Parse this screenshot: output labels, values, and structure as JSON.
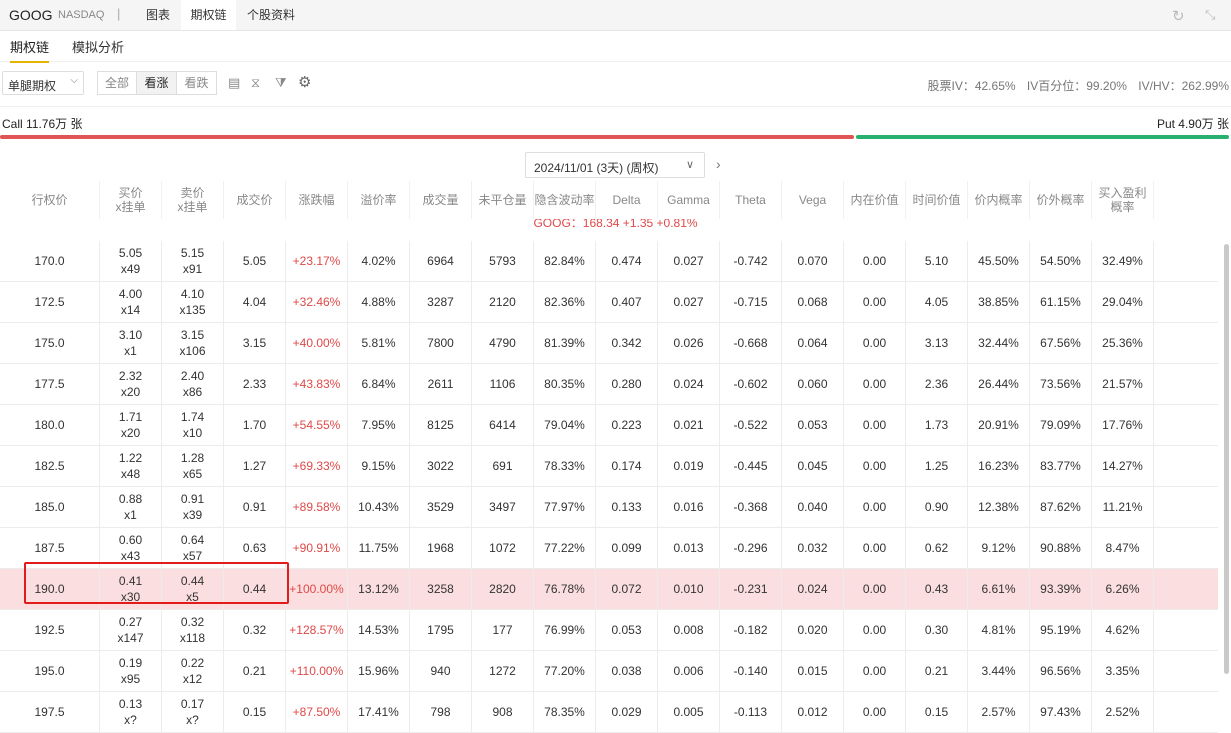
{
  "header": {
    "ticker": "GOOG",
    "exchange": "NASDAQ",
    "separator": "|",
    "tabs": [
      "图表",
      "期权链",
      "个股资料"
    ],
    "active_tab": "期权链",
    "refresh_icon": "refresh-icon",
    "compress_icon": "compress-icon"
  },
  "subtabs": [
    "期权链",
    "模拟分析"
  ],
  "toolbar": {
    "leg_select": "单腿期权",
    "filter_segments": [
      "全部",
      "看涨",
      "看跌"
    ],
    "active_filter": "看涨",
    "icons": [
      "layout-icon",
      "split-icon",
      "filter-icon",
      "settings-icon"
    ],
    "stock_iv": "股票IV：42.65%",
    "iv_percentile": "IV百分位：99.20%",
    "iv_hv": "IV/HV：262.99%"
  },
  "volume_bar": {
    "call_label": "Call 11.76万 张",
    "put_label": "Put 4.90万 张",
    "call_fraction": 0.706,
    "put_fraction": 0.294,
    "call_color": "#e05454",
    "put_color": "#27b06e"
  },
  "expiry": {
    "selected": "2024/11/01 (3天) (周权)"
  },
  "table": {
    "headers": [
      "行权价",
      "买价\nx挂单",
      "卖价\nx挂单",
      "成交价",
      "涨跌幅",
      "溢价率",
      "成交量",
      "未平仓量",
      "隐含波动率",
      "Delta",
      "Gamma",
      "Theta",
      "Vega",
      "内在价值",
      "时间价值",
      "价内概率",
      "价外概率",
      "买入盈利概率"
    ],
    "underlying_line": "GOOG：168.34 +1.35 +0.81%",
    "rows": [
      {
        "strike": "170.0",
        "bid": "5.05",
        "bid_size": "x49",
        "ask": "5.15",
        "ask_size": "x91",
        "last": "5.05",
        "chg": "+23.17%",
        "premium": "4.02%",
        "volume": "6964",
        "oi": "5793",
        "iv": "82.84%",
        "delta": "0.474",
        "gamma": "0.027",
        "theta": "-0.742",
        "vega": "0.070",
        "intrinsic": "0.00",
        "time_value": "5.10",
        "itm_prob": "45.50%",
        "otm_prob": "54.50%",
        "profit_prob": "32.49%"
      },
      {
        "strike": "172.5",
        "bid": "4.00",
        "bid_size": "x14",
        "ask": "4.10",
        "ask_size": "x135",
        "last": "4.04",
        "chg": "+32.46%",
        "premium": "4.88%",
        "volume": "3287",
        "oi": "2120",
        "iv": "82.36%",
        "delta": "0.407",
        "gamma": "0.027",
        "theta": "-0.715",
        "vega": "0.068",
        "intrinsic": "0.00",
        "time_value": "4.05",
        "itm_prob": "38.85%",
        "otm_prob": "61.15%",
        "profit_prob": "29.04%"
      },
      {
        "strike": "175.0",
        "bid": "3.10",
        "bid_size": "x1",
        "ask": "3.15",
        "ask_size": "x106",
        "last": "3.15",
        "chg": "+40.00%",
        "premium": "5.81%",
        "volume": "7800",
        "oi": "4790",
        "iv": "81.39%",
        "delta": "0.342",
        "gamma": "0.026",
        "theta": "-0.668",
        "vega": "0.064",
        "intrinsic": "0.00",
        "time_value": "3.13",
        "itm_prob": "32.44%",
        "otm_prob": "67.56%",
        "profit_prob": "25.36%"
      },
      {
        "strike": "177.5",
        "bid": "2.32",
        "bid_size": "x20",
        "ask": "2.40",
        "ask_size": "x86",
        "last": "2.33",
        "chg": "+43.83%",
        "premium": "6.84%",
        "volume": "2611",
        "oi": "1106",
        "iv": "80.35%",
        "delta": "0.280",
        "gamma": "0.024",
        "theta": "-0.602",
        "vega": "0.060",
        "intrinsic": "0.00",
        "time_value": "2.36",
        "itm_prob": "26.44%",
        "otm_prob": "73.56%",
        "profit_prob": "21.57%"
      },
      {
        "strike": "180.0",
        "bid": "1.71",
        "bid_size": "x20",
        "ask": "1.74",
        "ask_size": "x10",
        "last": "1.70",
        "chg": "+54.55%",
        "premium": "7.95%",
        "volume": "8125",
        "oi": "6414",
        "iv": "79.04%",
        "delta": "0.223",
        "gamma": "0.021",
        "theta": "-0.522",
        "vega": "0.053",
        "intrinsic": "0.00",
        "time_value": "1.73",
        "itm_prob": "20.91%",
        "otm_prob": "79.09%",
        "profit_prob": "17.76%"
      },
      {
        "strike": "182.5",
        "bid": "1.22",
        "bid_size": "x48",
        "ask": "1.28",
        "ask_size": "x65",
        "last": "1.27",
        "chg": "+69.33%",
        "premium": "9.15%",
        "volume": "3022",
        "oi": "691",
        "iv": "78.33%",
        "delta": "0.174",
        "gamma": "0.019",
        "theta": "-0.445",
        "vega": "0.045",
        "intrinsic": "0.00",
        "time_value": "1.25",
        "itm_prob": "16.23%",
        "otm_prob": "83.77%",
        "profit_prob": "14.27%"
      },
      {
        "strike": "185.0",
        "bid": "0.88",
        "bid_size": "x1",
        "ask": "0.91",
        "ask_size": "x39",
        "last": "0.91",
        "chg": "+89.58%",
        "premium": "10.43%",
        "volume": "3529",
        "oi": "3497",
        "iv": "77.97%",
        "delta": "0.133",
        "gamma": "0.016",
        "theta": "-0.368",
        "vega": "0.040",
        "intrinsic": "0.00",
        "time_value": "0.90",
        "itm_prob": "12.38%",
        "otm_prob": "87.62%",
        "profit_prob": "11.21%"
      },
      {
        "strike": "187.5",
        "bid": "0.60",
        "bid_size": "x43",
        "ask": "0.64",
        "ask_size": "x57",
        "last": "0.63",
        "chg": "+90.91%",
        "premium": "11.75%",
        "volume": "1968",
        "oi": "1072",
        "iv": "77.22%",
        "delta": "0.099",
        "gamma": "0.013",
        "theta": "-0.296",
        "vega": "0.032",
        "intrinsic": "0.00",
        "time_value": "0.62",
        "itm_prob": "9.12%",
        "otm_prob": "90.88%",
        "profit_prob": "8.47%"
      },
      {
        "strike": "190.0",
        "bid": "0.41",
        "bid_size": "x30",
        "ask": "0.44",
        "ask_size": "x5",
        "last": "0.44",
        "chg": "+100.00%",
        "premium": "13.12%",
        "volume": "3258",
        "oi": "2820",
        "iv": "76.78%",
        "delta": "0.072",
        "gamma": "0.010",
        "theta": "-0.231",
        "vega": "0.024",
        "intrinsic": "0.00",
        "time_value": "0.43",
        "itm_prob": "6.61%",
        "otm_prob": "93.39%",
        "profit_prob": "6.26%"
      },
      {
        "strike": "192.5",
        "bid": "0.27",
        "bid_size": "x147",
        "ask": "0.32",
        "ask_size": "x118",
        "last": "0.32",
        "chg": "+128.57%",
        "premium": "14.53%",
        "volume": "1795",
        "oi": "177",
        "iv": "76.99%",
        "delta": "0.053",
        "gamma": "0.008",
        "theta": "-0.182",
        "vega": "0.020",
        "intrinsic": "0.00",
        "time_value": "0.30",
        "itm_prob": "4.81%",
        "otm_prob": "95.19%",
        "profit_prob": "4.62%"
      },
      {
        "strike": "195.0",
        "bid": "0.19",
        "bid_size": "x95",
        "ask": "0.22",
        "ask_size": "x12",
        "last": "0.21",
        "chg": "+110.00%",
        "premium": "15.96%",
        "volume": "940",
        "oi": "1272",
        "iv": "77.20%",
        "delta": "0.038",
        "gamma": "0.006",
        "theta": "-0.140",
        "vega": "0.015",
        "intrinsic": "0.00",
        "time_value": "0.21",
        "itm_prob": "3.44%",
        "otm_prob": "96.56%",
        "profit_prob": "3.35%"
      },
      {
        "strike": "197.5",
        "bid": "0.13",
        "bid_size": "x?",
        "ask": "0.17",
        "ask_size": "x?",
        "last": "0.15",
        "chg": "+87.50%",
        "premium": "17.41%",
        "volume": "798",
        "oi": "908",
        "iv": "78.35%",
        "delta": "0.029",
        "gamma": "0.005",
        "theta": "-0.113",
        "vega": "0.012",
        "intrinsic": "0.00",
        "time_value": "0.15",
        "itm_prob": "2.57%",
        "otm_prob": "97.43%",
        "profit_prob": "2.52%"
      }
    ],
    "highlighted_strike": "190.0"
  }
}
